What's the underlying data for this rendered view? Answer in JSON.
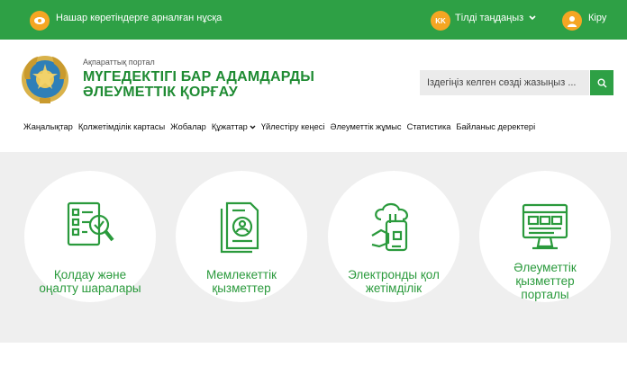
{
  "topbar": {
    "low_vision_label": "Нашар көретіндерге арналған нұсқа",
    "lang_code": "KK",
    "lang_select_label": "Тілді таңдаңыз",
    "login_label": "Кіру"
  },
  "header": {
    "portal_subtitle": "Ақпараттық портал",
    "title_line1": "МҮГЕДЕКТІГІ БАР АДАМДАРДЫ",
    "title_line2": "ӘЛЕУМЕТТІК ҚОРҒАУ",
    "search_placeholder": "Іздегіңіз келген сөзді жазыңыз ..."
  },
  "nav": {
    "items": [
      {
        "label": "Жаңалықтар"
      },
      {
        "label": "Қолжетімділік картасы"
      },
      {
        "label": "Жобалар"
      },
      {
        "label": "Құжаттар"
      },
      {
        "label": "Үйлестіру кеңесі"
      },
      {
        "label": "Әлеуметтік жұмыс"
      },
      {
        "label": "Статистика"
      },
      {
        "label": "Байланыс деректері"
      }
    ]
  },
  "cards": [
    {
      "label_line1": "Қолдау және",
      "label_line2": "оңалту шаралары",
      "label_line3": "",
      "icon": "checklist-magnifier-icon"
    },
    {
      "label_line1": "Мемлекеттік",
      "label_line2": "қызметтер",
      "label_line3": "",
      "icon": "document-user-icon"
    },
    {
      "label_line1": "Электронды қол",
      "label_line2": "жетімділік",
      "label_line3": "",
      "icon": "cloud-phone-hand-icon"
    },
    {
      "label_line1": "Әлеуметтік",
      "label_line2": "қызметтер",
      "label_line3": "порталы",
      "icon": "monitor-web-icon"
    }
  ],
  "colors": {
    "green": "#2ea045",
    "accent": "#f5a623",
    "text_green": "#1f8b33"
  }
}
